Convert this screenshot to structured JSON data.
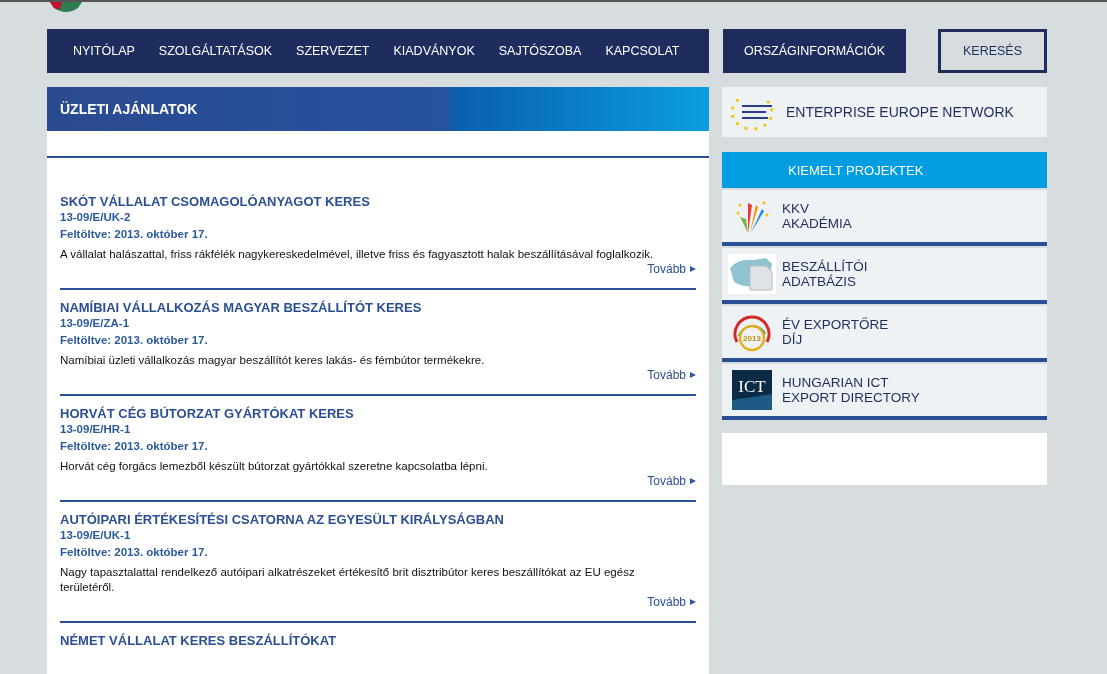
{
  "nav": {
    "items": [
      {
        "label": "NYITÓLAP"
      },
      {
        "label": "SZOLGÁLTATÁSOK"
      },
      {
        "label": "SZERVEZET"
      },
      {
        "label": "KIADVÁNYOK"
      },
      {
        "label": "SAJTÓSZOBA"
      },
      {
        "label": "KAPCSOLAT"
      }
    ],
    "country": "ORSZÁGINFORMÁCIÓK",
    "search": "KERESÉS"
  },
  "main": {
    "heading": "ÜZLETI AJÁNLATOK",
    "offers": [
      {
        "title": "SKÓT VÁLLALAT CSOMAGOLÓANYAGOT KERES",
        "code": "13-09/E/UK-2",
        "date": "Feltöltve: 2013. október 17.",
        "text": "A vállalat halászattal, friss rákfélék nagykereskedelmével, illetve friss és fagyasztott halak beszállításával foglalkozik.",
        "more": "Tovább"
      },
      {
        "title": "NAMÍBIAI VÁLLALKOZÁS MAGYAR BESZÁLLÍTÓT KERES",
        "code": "13-09/E/ZA-1",
        "date": "Feltöltve: 2013. október 17.",
        "text": "Namíbiai üzleti vállalkozás magyar beszállítót keres lakás- és fémbútor termékekre.",
        "more": "Tovább"
      },
      {
        "title": "HORVÁT CÉG BÚTORZAT GYÁRTÓKAT KERES",
        "code": "13-09/E/HR-1",
        "date": "Feltöltve: 2013. október 17.",
        "text": "Horvát cég forgács lemezből készült bútorzat gyártókkal szeretne kapcsolatba lépni.",
        "more": "Tovább"
      },
      {
        "title": "AUTÓIPARI ÉRTÉKESÍTÉSI CSATORNA AZ EGYESÜLT KIRÁLYSÁGBAN",
        "code": "13-09/E/UK-1",
        "date": "Feltöltve: 2013. október 17.",
        "text": "Nagy tapasztalattal rendelkező autóipari alkatrészeket értékesítő brit disztribútor keres beszállítókat az EU egész területéről.",
        "more": "Tovább"
      },
      {
        "title": "NÉMET VÁLLALAT KERES BESZÁLLÍTÓKAT"
      }
    ]
  },
  "sidebar": {
    "network": "ENTERPRISE EUROPE NETWORK",
    "projects_heading": "KIEMELT PROJEKTEK",
    "projects": [
      {
        "kind": "academy",
        "lines": [
          "KKV",
          "AKADÉMIA"
        ]
      },
      {
        "kind": "database",
        "lines": [
          "BESZÁLLÍTÓI",
          "ADATBÁZIS"
        ]
      },
      {
        "kind": "award",
        "lines": [
          "ÉV EXPORTŐRE",
          "DÍJ"
        ],
        "badge": "2013"
      },
      {
        "kind": "ict",
        "lines": [
          "HUNGARIAN ICT",
          "EXPORT DIRECTORY"
        ],
        "badge": "ICT"
      }
    ]
  }
}
